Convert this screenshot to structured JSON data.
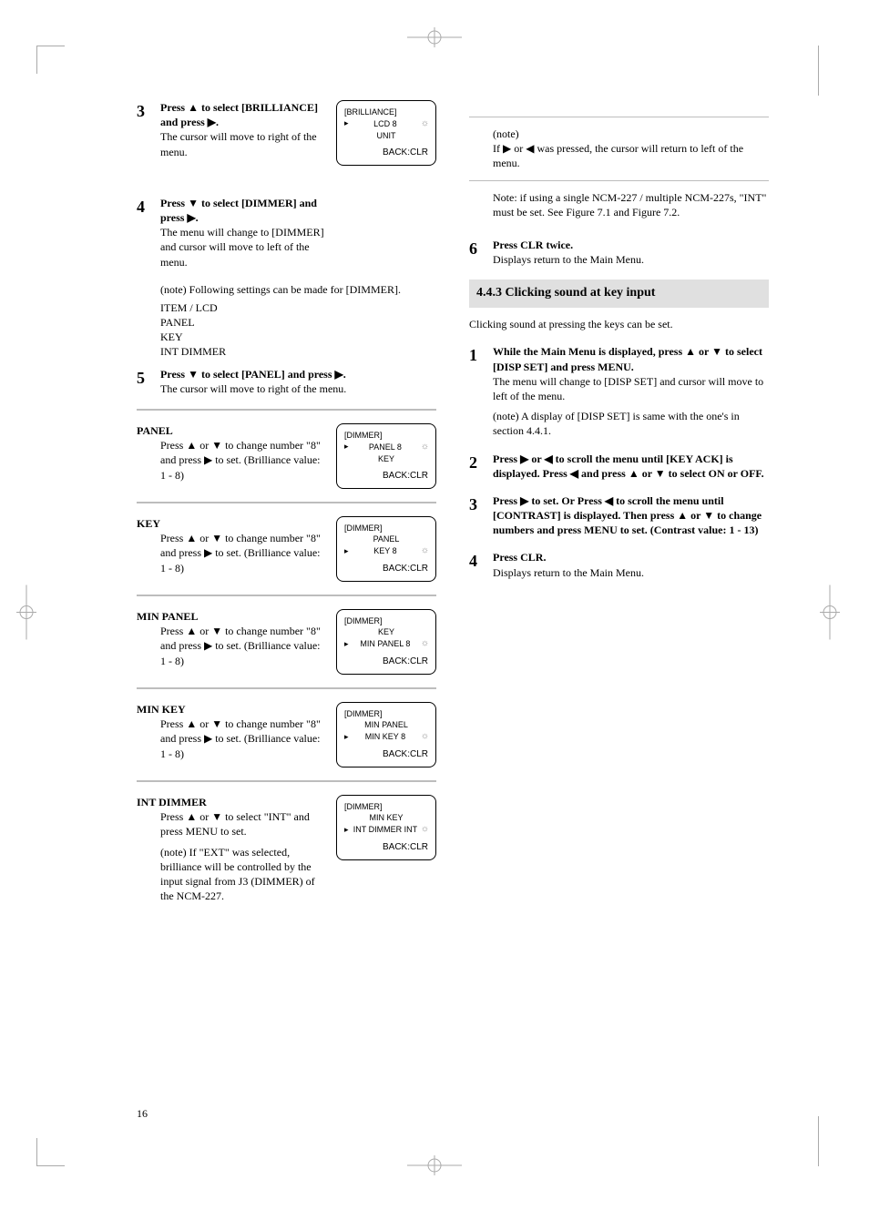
{
  "page_number": "16",
  "left": {
    "s3": {
      "n": "3",
      "t": "Press ▲ to select [BRILLIANCE] and press ▶.",
      "sub": "The cursor will move to right of the menu."
    },
    "s4": {
      "n": "4",
      "t": "Press ▼ to select [DIMMER] and press ▶.",
      "sub": "The menu will change to [DIMMER] and cursor will move to left of the menu.",
      "note": "(note) Following settings can be made for [DIMMER].",
      "table_head": "ITEM / LCD",
      "items": [
        "PANEL",
        "KEY",
        "INT DIMMER"
      ]
    },
    "s5": {
      "n": "5",
      "t": "Press ▼ to select [PANEL] and press ▶.",
      "sub": "The cursor will move to right of the menu."
    },
    "panel": {
      "head": "PANEL",
      "body": "Press ▲ or ▼ to change number \"8\" and press ▶ to set.           (Brilliance value: 1 - 8)"
    },
    "key": {
      "head": "KEY",
      "body": "Press ▲ or ▼ to change number \"8\" and press ▶ to set.           (Brilliance value: 1 - 8)"
    },
    "minpanel": {
      "head": "MIN PANEL",
      "body": "Press ▲ or ▼ to change number \"8\" and press ▶ to set.           (Brilliance value: 1 - 8)"
    },
    "minkey": {
      "head": "MIN KEY",
      "body": "Press ▲ or ▼ to change number \"8\" and press ▶ to set.           (Brilliance value: 1 - 8)"
    },
    "intdimmer": {
      "head": "INT DIMMER",
      "body": "Press ▲ or ▼ to select \"INT\" and press MENU to set.",
      "note": "(note) If \"EXT\" was selected, brilliance will be controlled by the input signal from J3 (DIMMER) of the NCM-227."
    },
    "lcd_brilliance": {
      "title": "[BRILLIANCE]",
      "items": [
        "LCD             8",
        "UNIT"
      ],
      "note": "BACK:CLR"
    },
    "lcd_dimmer_panel": {
      "title": "[DIMMER]",
      "items": [
        "PANEL          8",
        "KEY"
      ],
      "note": "BACK:CLR"
    },
    "lcd_dimmer_key": {
      "title": "[DIMMER]",
      "items": [
        "PANEL",
        "KEY              8"
      ],
      "note": "BACK:CLR"
    },
    "lcd_dimmer_minpanel": {
      "title": "[DIMMER]",
      "items": [
        "KEY",
        "MIN PANEL   8"
      ],
      "note": "BACK:CLR"
    },
    "lcd_dimmer_minkey": {
      "title": "[DIMMER]",
      "items": [
        "MIN PANEL",
        "MIN KEY       8"
      ],
      "note": "BACK:CLR"
    },
    "lcd_dimmer_int": {
      "title": "[DIMMER]",
      "items": [
        "MIN KEY",
        "INT DIMMER  INT"
      ],
      "note": "BACK:CLR"
    }
  },
  "right": {
    "note_head": "(note)",
    "note1": "If ▶ or ◀ was pressed, the cursor will return to left of the menu.",
    "note2": "Note: if using a single NCM-227 / multiple NCM-227s, \"INT\" must be set. See Figure 7.1 and Figure 7.2.",
    "s6": {
      "n": "6",
      "t": "Press CLR twice.",
      "sub": "Displays return to the Main Menu."
    },
    "band": "4.4.3 Clicking sound at key input",
    "intro": "Clicking sound at pressing the keys can be set.",
    "s1": {
      "n": "1",
      "t": "While the Main Menu is displayed, press ▲ or ▼ to select [DISP SET] and press MENU.",
      "sub": "The menu will change to [DISP SET] and cursor will move to left of the menu.",
      "note": "(note) A display of [DISP SET] is same with the one's in section 4.4.1."
    },
    "s2": {
      "n": "2",
      "t": "Press ▶ or ◀ to scroll the menu until [KEY ACK] is displayed. Press ◀ and press ▲ or ▼ to select ON or OFF.",
      "sub": ""
    },
    "s3": {
      "n": "3",
      "t": "Press ▶ to set. Or Press ◀ to scroll the menu until [CONTRAST] is displayed. Then press ▲ or ▼ to change numbers and press MENU to set.      (Contrast value: 1 - 13)"
    },
    "s4": {
      "n": "4",
      "t": "Press CLR.",
      "sub": "Displays return to the Main Menu."
    }
  }
}
